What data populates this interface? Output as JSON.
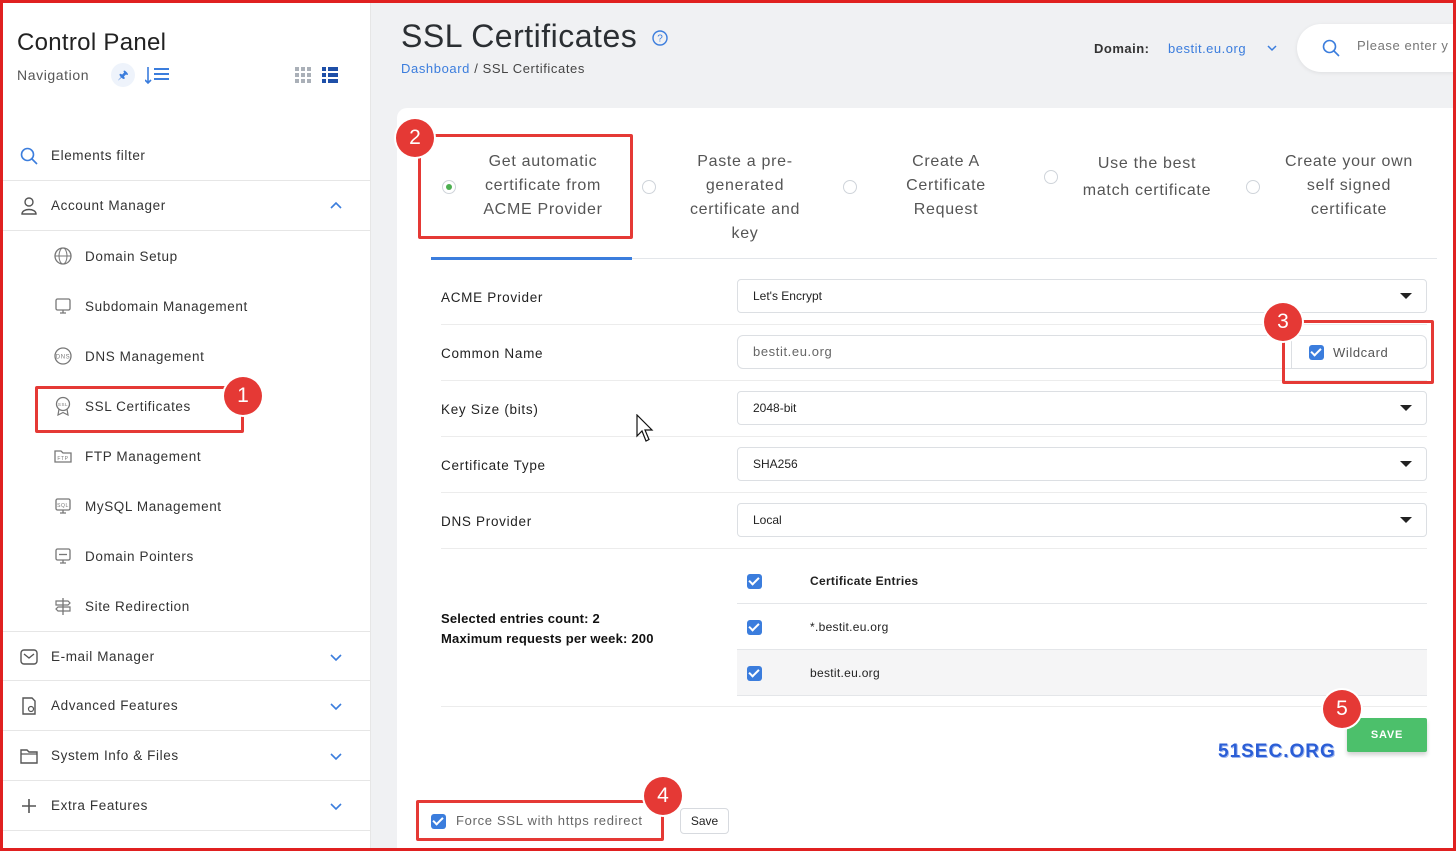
{
  "sidebar": {
    "title": "Control Panel",
    "nav_label": "Navigation",
    "filter_label": "Elements filter",
    "sections": {
      "account_manager": "Account Manager",
      "email_manager": "E-mail Manager",
      "advanced_features": "Advanced Features",
      "system_info": "System Info & Files",
      "extra_features": "Extra Features"
    },
    "items": {
      "domain_setup": "Domain Setup",
      "subdomain_management": "Subdomain Management",
      "dns_management": "DNS Management",
      "ssl_certificates": "SSL Certificates",
      "ftp_management": "FTP Management",
      "mysql_management": "MySQL Management",
      "domain_pointers": "Domain Pointers",
      "site_redirection": "Site Redirection"
    }
  },
  "header": {
    "title": "SSL Certificates",
    "breadcrumb_link": "Dashboard",
    "breadcrumb_sep": " / ",
    "breadcrumb_current": "SSL Certificates",
    "domain_label": "Domain:",
    "domain_value": "bestit.eu.org",
    "search_placeholder": "Please enter y"
  },
  "tabs": [
    {
      "line1": "Get automatic",
      "line2": "certificate from",
      "line3": "ACME Provider",
      "selected": true
    },
    {
      "line1": "Paste a pre-",
      "line2": "generated",
      "line3": "certificate and",
      "line4": "key",
      "selected": false
    },
    {
      "line1": "Create A",
      "line2": "Certificate",
      "line3": "Request",
      "selected": false
    },
    {
      "line1": "Use the best",
      "line2": "match certificate",
      "selected": false
    },
    {
      "line1": "Create your own",
      "line2": "self signed",
      "line3": "certificate",
      "selected": false
    }
  ],
  "form": {
    "acme_provider_label": "ACME Provider",
    "acme_provider_value": "Let's Encrypt",
    "common_name_label": "Common Name",
    "common_name_value": "bestit.eu.org",
    "wildcard_label": "Wildcard",
    "key_size_label": "Key Size (bits)",
    "key_size_value": "2048-bit",
    "cert_type_label": "Certificate Type",
    "cert_type_value": "SHA256",
    "dns_provider_label": "DNS Provider",
    "dns_provider_value": "Local"
  },
  "entries": {
    "count_label": "Selected entries count:",
    "count_value": "2",
    "max_label": "Maximum requests per week:",
    "max_value": "200",
    "header": "Certificate Entries",
    "rows": [
      "*.bestit.eu.org",
      "bestit.eu.org"
    ]
  },
  "actions": {
    "save_label": "SAVE",
    "force_ssl_label": "Force SSL with https redirect",
    "small_save_label": "Save"
  },
  "watermark": "51SEC.ORG",
  "annotations": [
    "1",
    "2",
    "3",
    "4",
    "5"
  ],
  "colors": {
    "accent": "#3b7ddd",
    "save_green": "#4cc06b",
    "annotation_red": "#e53935"
  }
}
